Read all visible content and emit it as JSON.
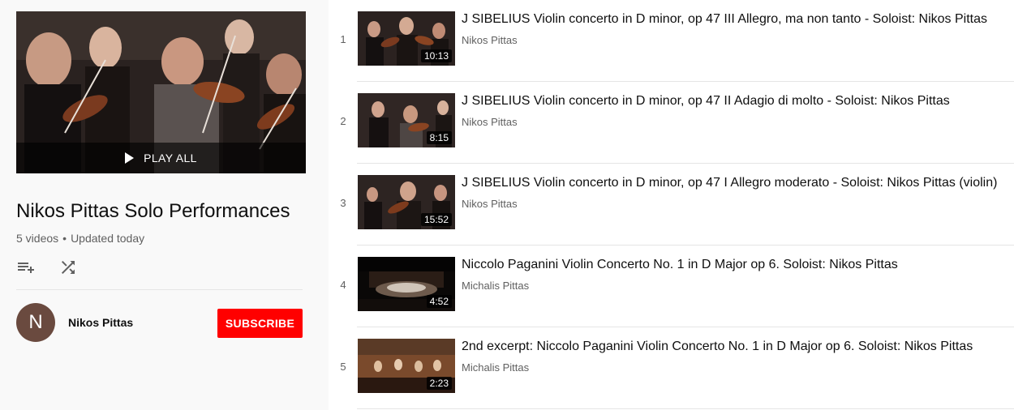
{
  "playlist": {
    "play_all_label": "PLAY ALL",
    "title": "Nikos Pittas Solo Performances",
    "video_count": "5 videos",
    "separator": "•",
    "updated": "Updated today",
    "icons": {
      "add_to_queue": "playlist-add-icon",
      "shuffle": "shuffle-icon",
      "play": "play-icon"
    }
  },
  "owner": {
    "avatar_letter": "N",
    "avatar_color": "#6a4a3f",
    "name": "Nikos Pittas",
    "subscribe_label": "SUBSCRIBE",
    "subscribe_color": "#ff0000"
  },
  "videos": [
    {
      "index": "1",
      "title": "J SIBELIUS Violin concerto in D minor, op 47 III Allegro, ma non tanto - Soloist: Nikos Pittas",
      "channel": "Nikos Pittas",
      "duration": "10:13"
    },
    {
      "index": "2",
      "title": "J SIBELIUS Violin concerto in D minor, op 47 II Adagio di molto - Soloist: Nikos Pittas",
      "channel": "Nikos Pittas",
      "duration": "8:15"
    },
    {
      "index": "3",
      "title": "J SIBELIUS Violin concerto in D minor, op 47 I Allegro moderato - Soloist: Nikos Pittas (violin)",
      "channel": "Nikos Pittas",
      "duration": "15:52"
    },
    {
      "index": "4",
      "title": "Niccolo Paganini Violin Concerto No. 1 in D Major op 6. Soloist: Nikos Pittas",
      "channel": "Michalis Pittas",
      "duration": "4:52"
    },
    {
      "index": "5",
      "title": "2nd excerpt: Niccolo Paganini Violin Concerto No. 1 in D Major op 6. Soloist: Nikos Pittas",
      "channel": "Michalis Pittas",
      "duration": "2:23"
    }
  ]
}
